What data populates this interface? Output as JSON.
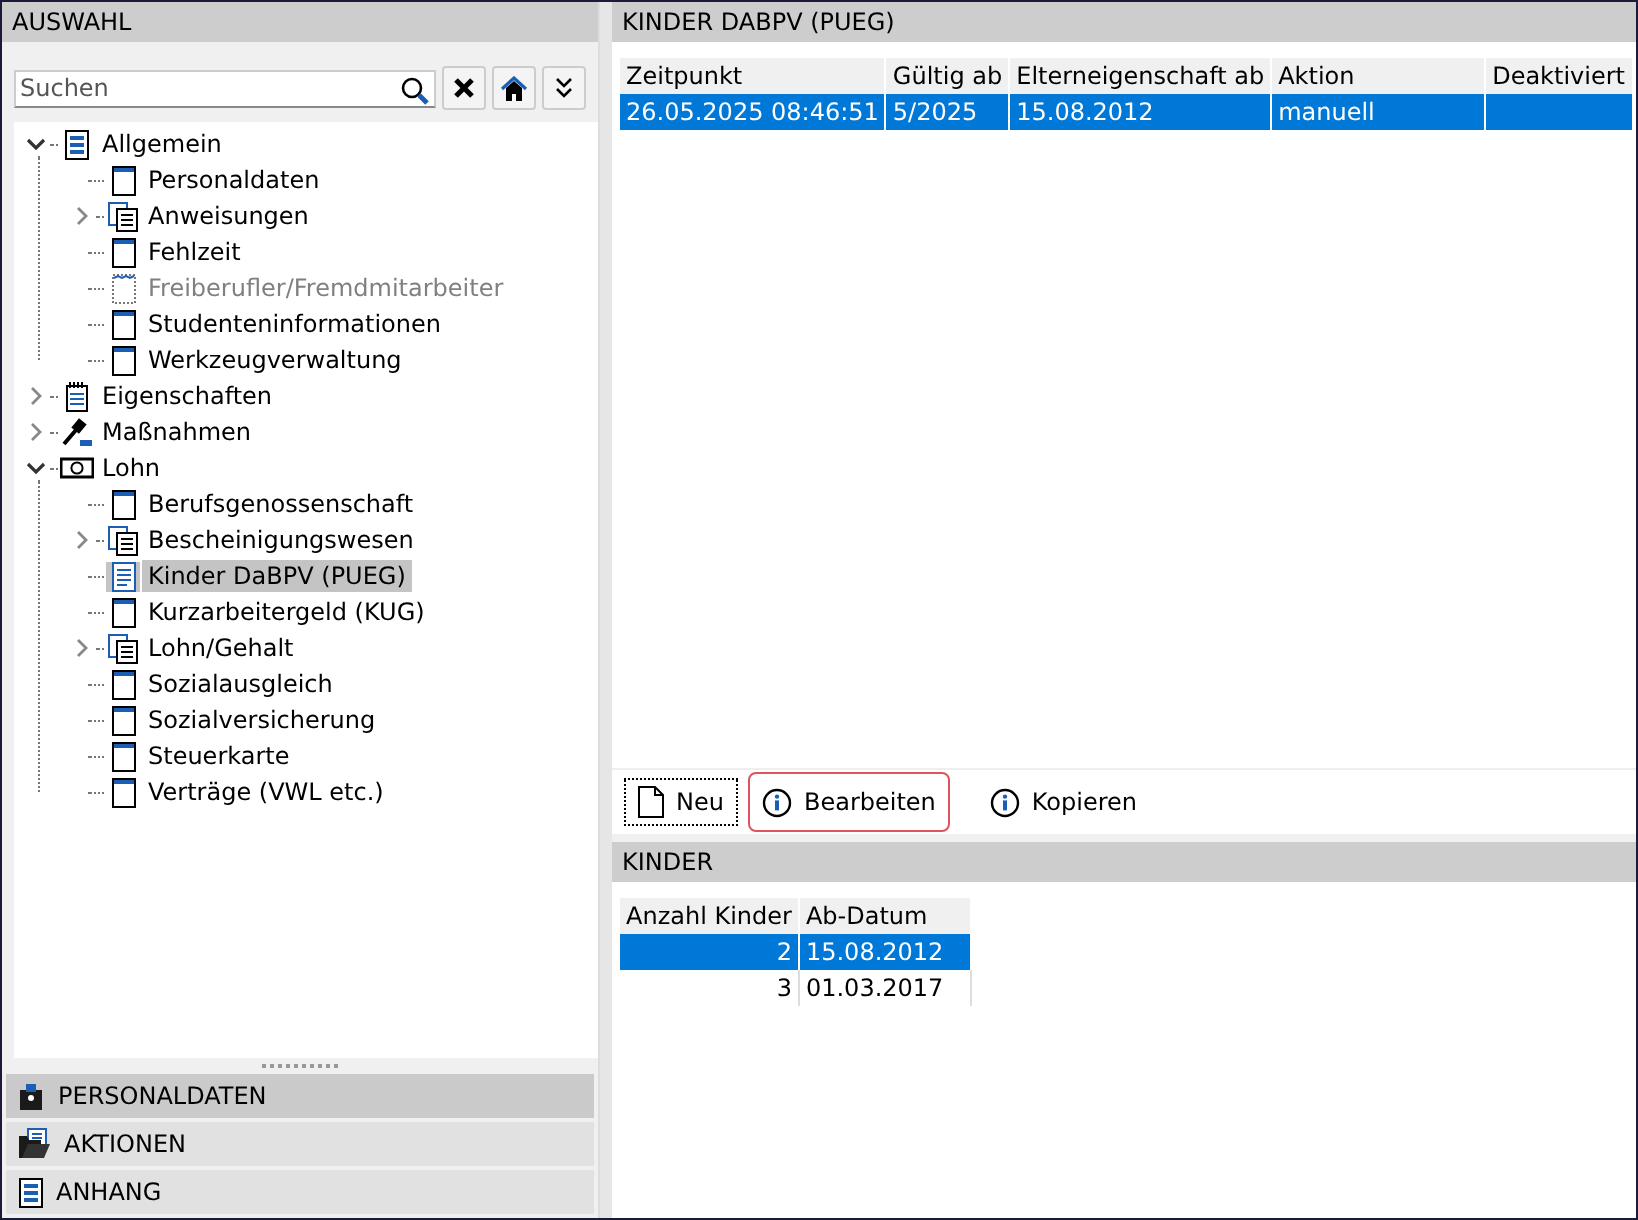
{
  "left_panel": {
    "title": "AUSWAHL",
    "search": {
      "placeholder": "Suchen"
    },
    "tree": [
      {
        "label": "Allgemein",
        "kind": "list",
        "expanded": true,
        "selected": false,
        "children": [
          {
            "label": "Personaldaten",
            "kind": "page",
            "selected": false
          },
          {
            "label": "Anweisungen",
            "kind": "stack",
            "expanded": false,
            "selected": false
          },
          {
            "label": "Fehlzeit",
            "kind": "page",
            "selected": false
          },
          {
            "label": "Freiberufler/Fremdmitarbeiter",
            "kind": "page",
            "disabled": true,
            "selected": false
          },
          {
            "label": "Studenteninformationen",
            "kind": "page",
            "selected": false
          },
          {
            "label": "Werkzeugverwaltung",
            "kind": "page",
            "selected": false
          }
        ]
      },
      {
        "label": "Eigenschaften",
        "kind": "notepad",
        "expanded": false,
        "selected": false
      },
      {
        "label": "Maßnahmen",
        "kind": "gavel",
        "expanded": false,
        "selected": false
      },
      {
        "label": "Lohn",
        "kind": "money",
        "expanded": true,
        "selected": false,
        "children": [
          {
            "label": "Berufsgenossenschaft",
            "kind": "page",
            "selected": false
          },
          {
            "label": "Bescheinigungswesen",
            "kind": "stack",
            "expanded": false,
            "selected": false
          },
          {
            "label": "Kinder DaBPV (PUEG)",
            "kind": "text",
            "selected": true
          },
          {
            "label": "Kurzarbeitergeld (KUG)",
            "kind": "page",
            "selected": false
          },
          {
            "label": "Lohn/Gehalt",
            "kind": "stack",
            "expanded": false,
            "selected": false
          },
          {
            "label": "Sozialausgleich",
            "kind": "page",
            "selected": false
          },
          {
            "label": "Sozialversicherung",
            "kind": "page",
            "selected": false
          },
          {
            "label": "Steuerkarte",
            "kind": "page",
            "selected": false
          },
          {
            "label": "Verträge (VWL etc.)",
            "kind": "page",
            "selected": false
          }
        ]
      }
    ],
    "sections": [
      {
        "label": "PERSONALDATEN",
        "kind": "person",
        "selected": true
      },
      {
        "label": "AKTIONEN",
        "kind": "folder",
        "selected": false
      },
      {
        "label": "ANHANG",
        "kind": "list",
        "selected": false
      }
    ]
  },
  "main_panel": {
    "title": "KINDER DABPV (PUEG)",
    "table": {
      "columns": [
        "Zeitpunkt",
        "Gültig ab",
        "Elterneigenschaft ab",
        "Aktion",
        "Deaktiviert"
      ],
      "rows": [
        {
          "cells": [
            "26.05.2025 08:46:51",
            "5/2025",
            "15.08.2012",
            "manuell",
            ""
          ],
          "selected": true
        }
      ]
    },
    "buttons": [
      {
        "label": "Neu",
        "kind": "new",
        "focused": true,
        "highlighted": false
      },
      {
        "label": "Bearbeiten",
        "kind": "info",
        "focused": false,
        "highlighted": true
      },
      {
        "label": "Kopieren",
        "kind": "info",
        "focused": false,
        "highlighted": false
      }
    ]
  },
  "detail_panel": {
    "title": "KINDER",
    "table": {
      "columns": [
        "Anzahl Kinder",
        "Ab-Datum"
      ],
      "rows": [
        {
          "cells": [
            "2",
            "15.08.2012"
          ],
          "selected": true
        },
        {
          "cells": [
            "3",
            "01.03.2017"
          ],
          "selected": false
        }
      ]
    }
  }
}
